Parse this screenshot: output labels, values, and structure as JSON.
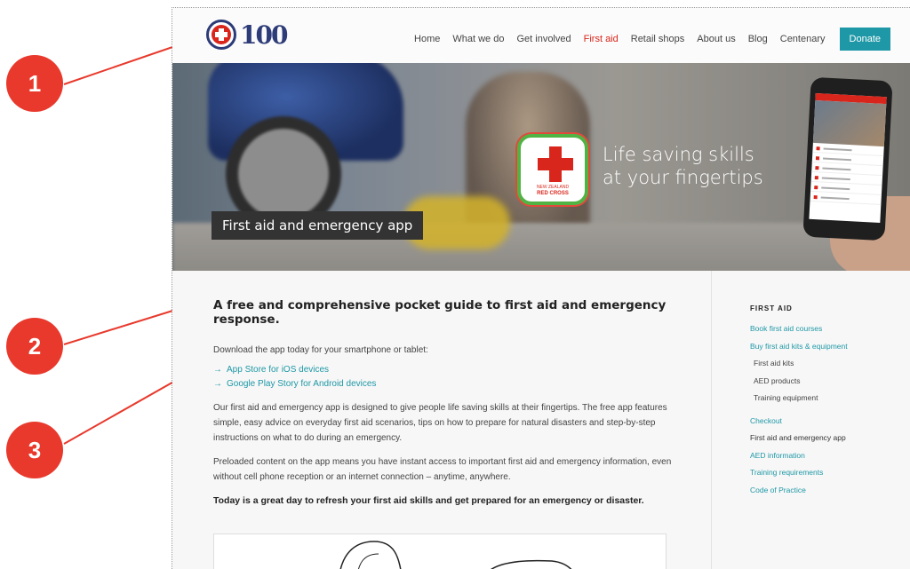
{
  "callouts": [
    "1",
    "2",
    "3"
  ],
  "header": {
    "logo_text": "100",
    "nav": [
      {
        "label": "Home",
        "active": false
      },
      {
        "label": "What we do",
        "active": false
      },
      {
        "label": "Get involved",
        "active": false
      },
      {
        "label": "First aid",
        "active": true
      },
      {
        "label": "Retail shops",
        "active": false
      },
      {
        "label": "About us",
        "active": false
      },
      {
        "label": "Blog",
        "active": false
      },
      {
        "label": "Centenary",
        "active": false
      }
    ],
    "donate_label": "Donate"
  },
  "hero": {
    "app_label_small": "NEW ZEALAND",
    "app_label_big": "RED CROSS",
    "tagline_line1": "Life saving skills",
    "tagline_line2": "at your fingertips",
    "caption": "First aid and emergency app"
  },
  "main": {
    "headline": "A free and comprehensive pocket guide to first aid and emergency response.",
    "download_intro": "Download the app today for your smartphone or tablet:",
    "links": [
      "App Store for iOS devices",
      "Google Play Story for Android devices"
    ],
    "para1": "Our first aid and emergency app is designed to give people life saving skills at their fingertips. The free app features simple, easy advice on everyday first aid scenarios, tips on how to prepare for natural disasters and step-by-step instructions on what to do during an emergency.",
    "para2": "Preloaded content on the app means you have instant access to important first aid and emergency information, even without cell phone reception or an internet connection – anytime, anywhere.",
    "bold_para": "Today is a great day to refresh your first aid skills and get prepared for an emergency or disaster."
  },
  "sidebar": {
    "title": "FIRST AID",
    "link_courses": "Book first aid courses",
    "link_kits": "Buy first aid kits & equipment",
    "sub_items": [
      "First aid kits",
      "AED products",
      "Training equipment"
    ],
    "link_checkout": "Checkout",
    "current_item": "First aid and emergency app",
    "links_after": [
      "AED information",
      "Training requirements",
      "Code of Practice"
    ]
  },
  "colors": {
    "callout": "#e8392c",
    "accent_teal": "#1e98a6",
    "nav_active": "#d9261c",
    "brand_navy": "#2d3c78"
  },
  "icons": [
    "red-cross-logo-icon",
    "arrow-right-icon",
    "red-cross-app-icon"
  ]
}
